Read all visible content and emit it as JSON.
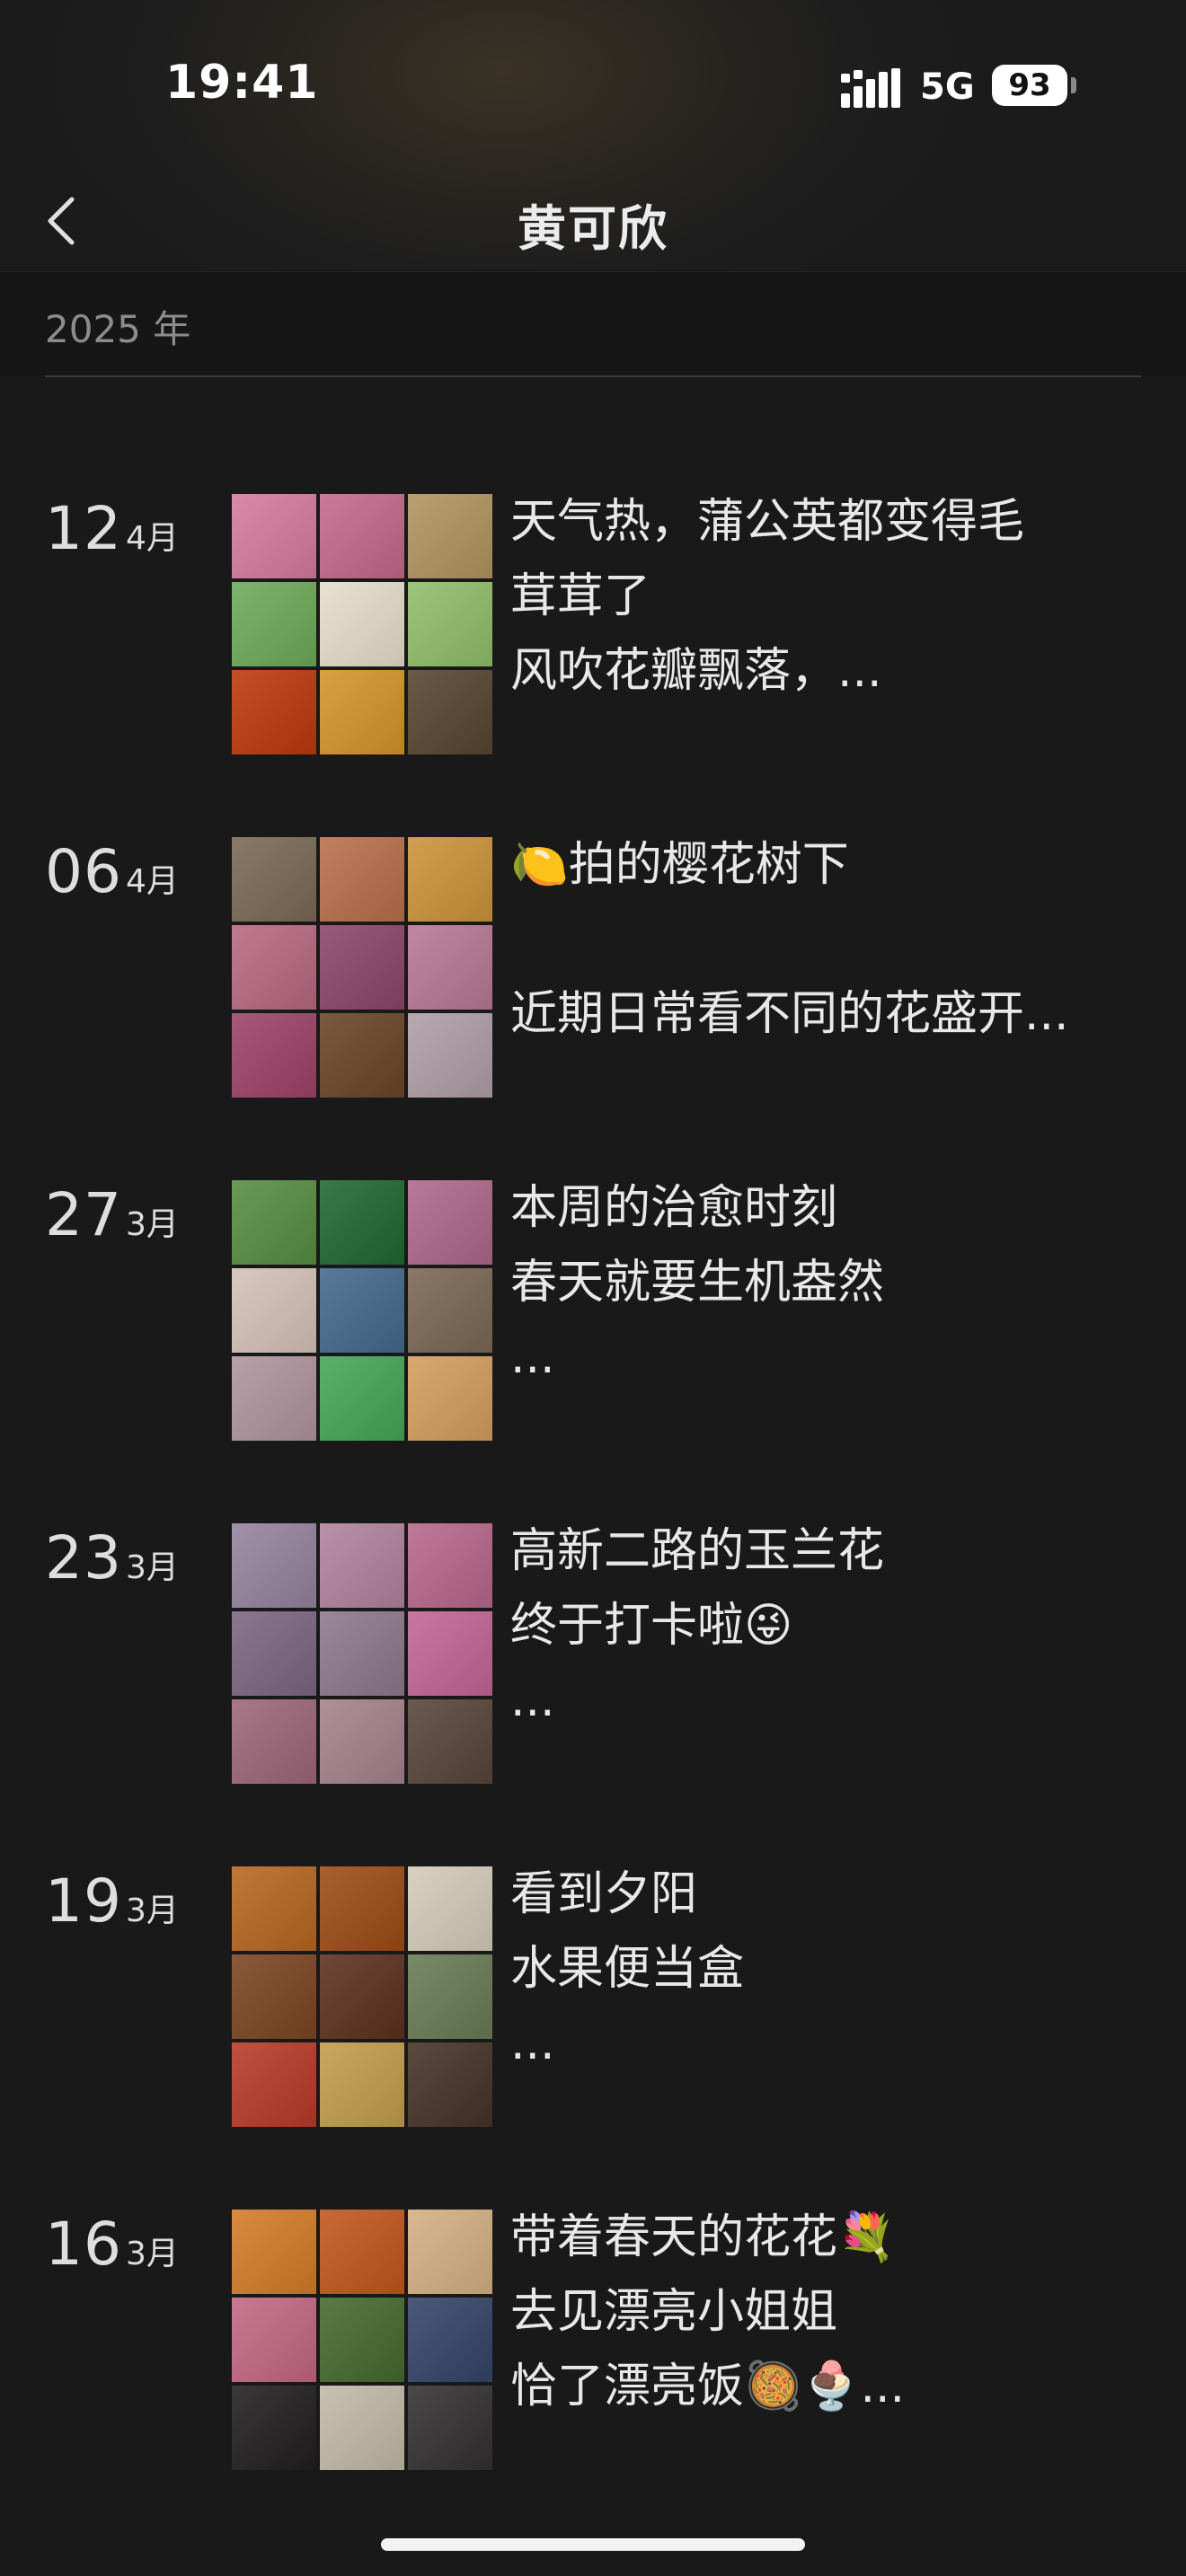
{
  "status_bar": {
    "time": "19:41",
    "network": "5G",
    "battery": "93"
  },
  "nav": {
    "title": "黄可欣",
    "back_icon": "chevron-left-icon"
  },
  "section": {
    "year": "2025 年"
  },
  "entries": [
    {
      "day": "12",
      "month": "4月",
      "lines": [
        "天气热，蒲公英都变得毛",
        "茸茸了",
        "风吹花瓣飘落，..."
      ],
      "thumb_colors": [
        "#d98aa8",
        "#c97a96",
        "#b8a070",
        "#7db36a",
        "#e8e0d0",
        "#9cc47a",
        "#c4502a",
        "#d8a040",
        "#6a5a48"
      ]
    },
    {
      "day": "06",
      "month": "4月",
      "lines": [
        "🍋拍的樱花树下",
        "",
        "近期日常看不同的花盛开..."
      ],
      "thumb_colors": [
        "#8a7a6a",
        "#c08060",
        "#d0a050",
        "#c07a90",
        "#9a5a7a",
        "#c088a0",
        "#a85878",
        "#7a5a40",
        "#b8a8b0"
      ]
    },
    {
      "day": "27",
      "month": "3月",
      "lines": [
        "本周的治愈时刻",
        "春天就要生机盎然",
        "..."
      ],
      "thumb_colors": [
        "#6a9a58",
        "#3a7a48",
        "#b87898",
        "#d8c8c0",
        "#5a7a9a",
        "#8a7868",
        "#b8a0a8",
        "#5ab06a",
        "#d8a870"
      ]
    },
    {
      "day": "23",
      "month": "3月",
      "lines": [
        "高新二路的玉兰花",
        "终于打卡啦😜",
        "..."
      ],
      "thumb_colors": [
        "#a090a8",
        "#b890a8",
        "#c07898",
        "#8a7890",
        "#9a8898",
        "#c878a0",
        "#a87888",
        "#b09098",
        "#6a5a50"
      ]
    },
    {
      "day": "19",
      "month": "3月",
      "lines": [
        "看到夕阳",
        "水果便当盒",
        "..."
      ],
      "thumb_colors": [
        "#c0783a",
        "#a86030",
        "#d8d0c0",
        "#8a5a3a",
        "#704838",
        "#7a8a68",
        "#c05040",
        "#c8a860",
        "#5a4a40"
      ]
    },
    {
      "day": "16",
      "month": "3月",
      "lines": [
        "带着春天的花花💐",
        "去见漂亮小姐姐",
        "恰了漂亮饭🥘🍨..."
      ],
      "thumb_colors": [
        "#d88a40",
        "#c86a38",
        "#d8b890",
        "#c87890",
        "#5a7a48",
        "#4a5a78",
        "#3a3838",
        "#c8c0b0",
        "#4a4848"
      ]
    }
  ]
}
